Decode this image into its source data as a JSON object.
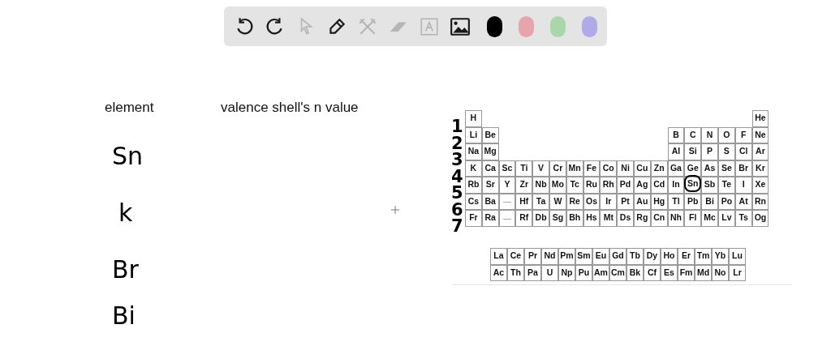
{
  "toolbar": {
    "tools": [
      {
        "kind": "undo",
        "disabled": false
      },
      {
        "kind": "redo",
        "disabled": false
      },
      {
        "kind": "select",
        "disabled": true
      },
      {
        "kind": "pen",
        "disabled": false
      },
      {
        "kind": "shapes",
        "disabled": true
      },
      {
        "kind": "eraser",
        "disabled": true
      },
      {
        "kind": "text",
        "disabled": true
      },
      {
        "kind": "image",
        "disabled": false
      }
    ],
    "colors": [
      {
        "color": "#000000"
      },
      {
        "color": "#e8a4ad"
      },
      {
        "color": "#a9d7a9"
      },
      {
        "color": "#b1aaea"
      }
    ]
  },
  "headers": [
    "element",
    "valence shell's n value"
  ],
  "handwritten_elements": [
    "Sn",
    "k",
    "Br",
    "Bi"
  ],
  "periodic_table": {
    "rows": [
      {
        "label": "1",
        "left": [
          {
            "kind": "element",
            "symbol": "H",
            "circled": false
          }
        ],
        "right": [
          {
            "kind": "element",
            "symbol": "He",
            "circled": false
          }
        ]
      },
      {
        "label": "2",
        "left": [
          {
            "kind": "element",
            "symbol": "Li",
            "circled": false
          },
          {
            "kind": "element",
            "symbol": "Be",
            "circled": false
          }
        ],
        "right": [
          {
            "kind": "element",
            "symbol": "B",
            "circled": false
          },
          {
            "kind": "element",
            "symbol": "C",
            "circled": false
          },
          {
            "kind": "element",
            "symbol": "N",
            "circled": false
          },
          {
            "kind": "element",
            "symbol": "O",
            "circled": false
          },
          {
            "kind": "element",
            "symbol": "F",
            "circled": false
          },
          {
            "kind": "element",
            "symbol": "Ne",
            "circled": false
          }
        ]
      },
      {
        "label": "3",
        "left": [
          {
            "kind": "element",
            "symbol": "Na",
            "circled": false
          },
          {
            "kind": "element",
            "symbol": "Mg",
            "circled": false
          }
        ],
        "right": [
          {
            "kind": "element",
            "symbol": "Al",
            "circled": false
          },
          {
            "kind": "element",
            "symbol": "Si",
            "circled": false
          },
          {
            "kind": "element",
            "symbol": "P",
            "circled": false
          },
          {
            "kind": "element",
            "symbol": "S",
            "circled": false
          },
          {
            "kind": "element",
            "symbol": "Cl",
            "circled": false
          },
          {
            "kind": "element",
            "symbol": "Ar",
            "circled": false
          }
        ]
      },
      {
        "label": "4",
        "left": [
          {
            "kind": "element",
            "symbol": "K",
            "circled": false
          },
          {
            "kind": "element",
            "symbol": "Ca",
            "circled": false
          },
          {
            "kind": "element",
            "symbol": "Sc",
            "circled": false
          },
          {
            "kind": "element",
            "symbol": "Ti",
            "circled": false
          },
          {
            "kind": "element",
            "symbol": "V",
            "circled": false
          },
          {
            "kind": "element",
            "symbol": "Cr",
            "circled": false
          },
          {
            "kind": "element",
            "symbol": "Mn",
            "circled": false
          },
          {
            "kind": "element",
            "symbol": "Fe",
            "circled": false
          },
          {
            "kind": "element",
            "symbol": "Co",
            "circled": false
          },
          {
            "kind": "element",
            "symbol": "Ni",
            "circled": false
          },
          {
            "kind": "element",
            "symbol": "Cu",
            "circled": false
          },
          {
            "kind": "element",
            "symbol": "Zn",
            "circled": false
          },
          {
            "kind": "element",
            "symbol": "Ga",
            "circled": false
          },
          {
            "kind": "element",
            "symbol": "Ge",
            "circled": false
          },
          {
            "kind": "element",
            "symbol": "As",
            "circled": false
          },
          {
            "kind": "element",
            "symbol": "Se",
            "circled": false
          },
          {
            "kind": "element",
            "symbol": "Br",
            "circled": false
          },
          {
            "kind": "element",
            "symbol": "Kr",
            "circled": false
          }
        ],
        "right": []
      },
      {
        "label": "5",
        "left": [
          {
            "kind": "element",
            "symbol": "Rb",
            "circled": false
          },
          {
            "kind": "element",
            "symbol": "Sr",
            "circled": false
          },
          {
            "kind": "element",
            "symbol": "Y",
            "circled": false
          },
          {
            "kind": "element",
            "symbol": "Zr",
            "circled": false
          },
          {
            "kind": "element",
            "symbol": "Nb",
            "circled": false
          },
          {
            "kind": "element",
            "symbol": "Mo",
            "circled": false
          },
          {
            "kind": "element",
            "symbol": "Tc",
            "circled": false
          },
          {
            "kind": "element",
            "symbol": "Ru",
            "circled": false
          },
          {
            "kind": "element",
            "symbol": "Rh",
            "circled": false
          },
          {
            "kind": "element",
            "symbol": "Pd",
            "circled": false
          },
          {
            "kind": "element",
            "symbol": "Ag",
            "circled": false
          },
          {
            "kind": "element",
            "symbol": "Cd",
            "circled": false
          },
          {
            "kind": "element",
            "symbol": "In",
            "circled": false
          },
          {
            "kind": "element",
            "symbol": "Sn",
            "circled": true
          },
          {
            "kind": "element",
            "symbol": "Sb",
            "circled": false
          },
          {
            "kind": "element",
            "symbol": "Te",
            "circled": false
          },
          {
            "kind": "element",
            "symbol": "I",
            "circled": false
          },
          {
            "kind": "element",
            "symbol": "Xe",
            "circled": false
          }
        ],
        "right": []
      },
      {
        "label": "6",
        "left": [
          {
            "kind": "element",
            "symbol": "Cs",
            "circled": false
          },
          {
            "kind": "element",
            "symbol": "Ba",
            "circled": false
          },
          {
            "kind": "series"
          },
          {
            "kind": "element",
            "symbol": "Hf",
            "circled": false
          },
          {
            "kind": "element",
            "symbol": "Ta",
            "circled": false
          },
          {
            "kind": "element",
            "symbol": "W",
            "circled": false
          },
          {
            "kind": "element",
            "symbol": "Re",
            "circled": false
          },
          {
            "kind": "element",
            "symbol": "Os",
            "circled": false
          },
          {
            "kind": "element",
            "symbol": "Ir",
            "circled": false
          },
          {
            "kind": "element",
            "symbol": "Pt",
            "circled": false
          },
          {
            "kind": "element",
            "symbol": "Au",
            "circled": false
          },
          {
            "kind": "element",
            "symbol": "Hg",
            "circled": false
          },
          {
            "kind": "element",
            "symbol": "Tl",
            "circled": false
          },
          {
            "kind": "element",
            "symbol": "Pb",
            "circled": false
          },
          {
            "kind": "element",
            "symbol": "Bi",
            "circled": false
          },
          {
            "kind": "element",
            "symbol": "Po",
            "circled": false
          },
          {
            "kind": "element",
            "symbol": "At",
            "circled": false
          },
          {
            "kind": "element",
            "symbol": "Rn",
            "circled": false
          }
        ],
        "right": []
      },
      {
        "label": "7",
        "left": [
          {
            "kind": "element",
            "symbol": "Fr",
            "circled": false
          },
          {
            "kind": "element",
            "symbol": "Ra",
            "circled": false
          },
          {
            "kind": "series"
          },
          {
            "kind": "element",
            "symbol": "Rf",
            "circled": false
          },
          {
            "kind": "element",
            "symbol": "Db",
            "circled": false
          },
          {
            "kind": "element",
            "symbol": "Sg",
            "circled": false
          },
          {
            "kind": "element",
            "symbol": "Bh",
            "circled": false
          },
          {
            "kind": "element",
            "symbol": "Hs",
            "circled": false
          },
          {
            "kind": "element",
            "symbol": "Mt",
            "circled": false
          },
          {
            "kind": "element",
            "symbol": "Ds",
            "circled": false
          },
          {
            "kind": "element",
            "symbol": "Rg",
            "circled": false
          },
          {
            "kind": "element",
            "symbol": "Cn",
            "circled": false
          },
          {
            "kind": "element",
            "symbol": "Nh",
            "circled": false
          },
          {
            "kind": "element",
            "symbol": "Fl",
            "circled": false
          },
          {
            "kind": "element",
            "symbol": "Mc",
            "circled": false
          },
          {
            "kind": "element",
            "symbol": "Lv",
            "circled": false
          },
          {
            "kind": "element",
            "symbol": "Ts",
            "circled": false
          },
          {
            "kind": "element",
            "symbol": "Og",
            "circled": false
          }
        ],
        "right": []
      }
    ],
    "f_block": [
      [
        "La",
        "Ce",
        "Pr",
        "Nd",
        "Pm",
        "Sm",
        "Eu",
        "Gd",
        "Tb",
        "Dy",
        "Ho",
        "Er",
        "Tm",
        "Yb",
        "Lu"
      ],
      [
        "Ac",
        "Th",
        "Pa",
        "U",
        "Np",
        "Pu",
        "Am",
        "Cm",
        "Bk",
        "Cf",
        "Es",
        "Fm",
        "Md",
        "No",
        "Lr"
      ]
    ]
  }
}
